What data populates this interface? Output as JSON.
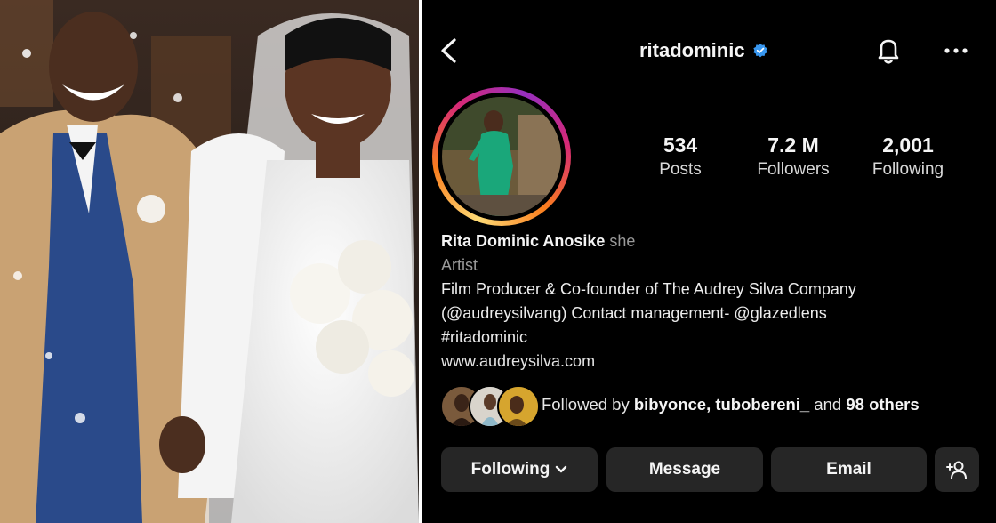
{
  "profile": {
    "username": "ritadominic",
    "verified_icon": "verified-badge-icon",
    "stats": [
      {
        "value": "534",
        "label": "Posts"
      },
      {
        "value": "7.2 M",
        "label": "Followers"
      },
      {
        "value": "2,001",
        "label": "Following"
      }
    ],
    "bio": {
      "name": "Rita Dominic Anosike",
      "pronoun": "she",
      "category": "Artist",
      "line1": "Film Producer & Co-founder of The Audrey Silva Company",
      "line2": "(@audreysilvang) Contact management- @glazedlens",
      "line3": "#ritadominic",
      "link": "www.audreysilva.com"
    },
    "followed_by": {
      "prefix": "Followed by",
      "names": "bibyonce, tubobereni_",
      "middle": "and",
      "others": "98 others"
    },
    "buttons": {
      "following": "Following",
      "message": "Message",
      "email": "Email"
    }
  },
  "colors": {
    "background": "#000000",
    "button_bg": "#262626",
    "verified": "#3897f0",
    "dress": "#1aa77a"
  },
  "icons": [
    "back-arrow-icon",
    "bell-icon",
    "more-options-icon",
    "chevron-down-icon",
    "add-person-icon"
  ]
}
